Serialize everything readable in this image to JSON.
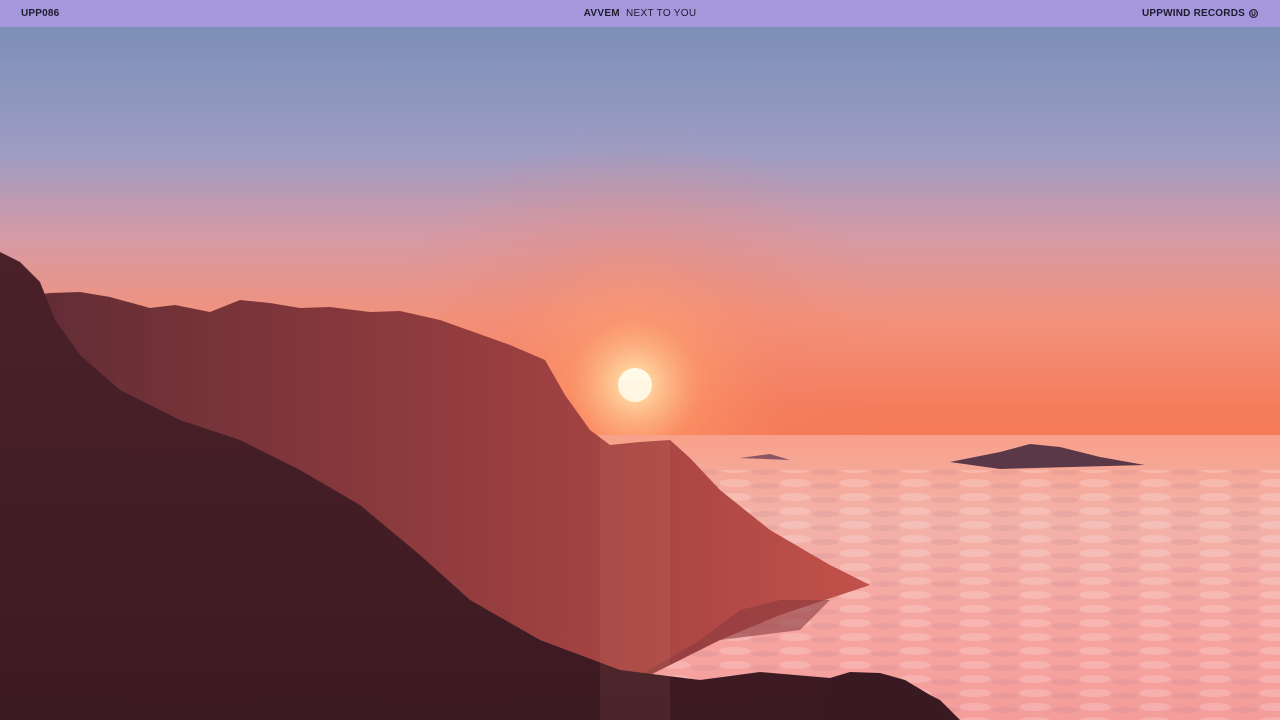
{
  "header": {
    "catalog_number": "UPP086",
    "artist": "AVVEM",
    "track_title": "NEXT TO YOU",
    "label_name": "UPPWIND RECORDS",
    "label_icon": "label-logo-icon",
    "bar_color": "#a597dc"
  },
  "scene": {
    "description_icon": "sunset-mountains-sea-of-clouds"
  }
}
